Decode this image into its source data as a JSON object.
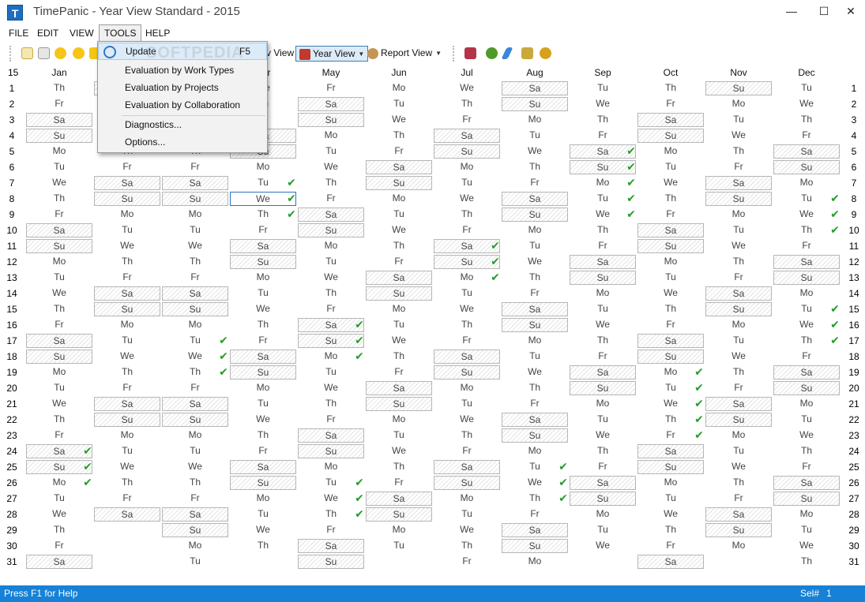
{
  "window": {
    "title": "TimePanic - Year View Standard - 2015",
    "app_icon": "T"
  },
  "window_controls": {
    "minimize": "—",
    "maximize": "☐",
    "close": "✕"
  },
  "menubar": {
    "items": [
      "FILE",
      "EDIT",
      "VIEW",
      "TOOLS",
      "HELP"
    ],
    "active": "TOOLS"
  },
  "toolbar": {
    "partial_view_label": "v View",
    "year_view_label": "Year View",
    "report_view_label": "Report View"
  },
  "tools_menu": {
    "watermark": "SOFTPEDIA",
    "items": [
      {
        "label": "Update",
        "shortcut": "F5",
        "highlighted": true,
        "icon": "refresh-icon"
      },
      {
        "label": "Evaluation by Work Types"
      },
      {
        "label": "Evaluation by Projects"
      },
      {
        "label": "Evaluation by Collaboration"
      },
      {
        "label": "Diagnostics..."
      },
      {
        "label": "Options..."
      }
    ]
  },
  "corner_label": "15",
  "months": [
    "Jan",
    "Feb",
    "Mar",
    "Apr",
    "May",
    "Jun",
    "Jul",
    "Aug",
    "Sep",
    "Oct",
    "Nov",
    "Dec"
  ],
  "row_numbers": [
    "1",
    "2",
    "3",
    "4",
    "5",
    "6",
    "7",
    "8",
    "9",
    "10",
    "11",
    "12",
    "13",
    "14",
    "15",
    "16",
    "17",
    "18",
    "19",
    "20",
    "21",
    "22",
    "23",
    "24",
    "25",
    "26",
    "27",
    "28",
    "29",
    "30",
    "31"
  ],
  "year_grid": {
    "first_weekday_index": [
      3,
      6,
      6,
      2,
      4,
      0,
      2,
      5,
      1,
      3,
      6,
      1
    ],
    "days_in_month": [
      31,
      28,
      31,
      30,
      31,
      30,
      31,
      31,
      30,
      31,
      30,
      31
    ],
    "weekday_abbr": [
      "Mo",
      "Tu",
      "We",
      "Th",
      "Fr",
      "Sa",
      "Su"
    ],
    "selected": {
      "month": 4,
      "day": 8
    },
    "checked": {
      "1": [
        24,
        25,
        26
      ],
      "2": [
        1,
        2,
        3,
        4
      ],
      "3": [
        17,
        18,
        19
      ],
      "4": [
        7,
        8,
        9
      ],
      "5": [
        16,
        17,
        18,
        26,
        27,
        28
      ],
      "7": [
        11,
        12,
        13
      ],
      "8": [
        25,
        26,
        27
      ],
      "9": [
        5,
        6,
        7,
        8,
        9
      ],
      "10": [
        19,
        20,
        21,
        22,
        23
      ],
      "12": [
        8,
        9,
        10,
        15,
        16,
        17
      ]
    }
  },
  "statusbar": {
    "help": "Press F1 for Help",
    "sel_label": "Sel#",
    "sel_count": "1"
  },
  "colors": {
    "accent": "#1681d6",
    "check": "#22a02c",
    "selection": "#2e72c3"
  }
}
